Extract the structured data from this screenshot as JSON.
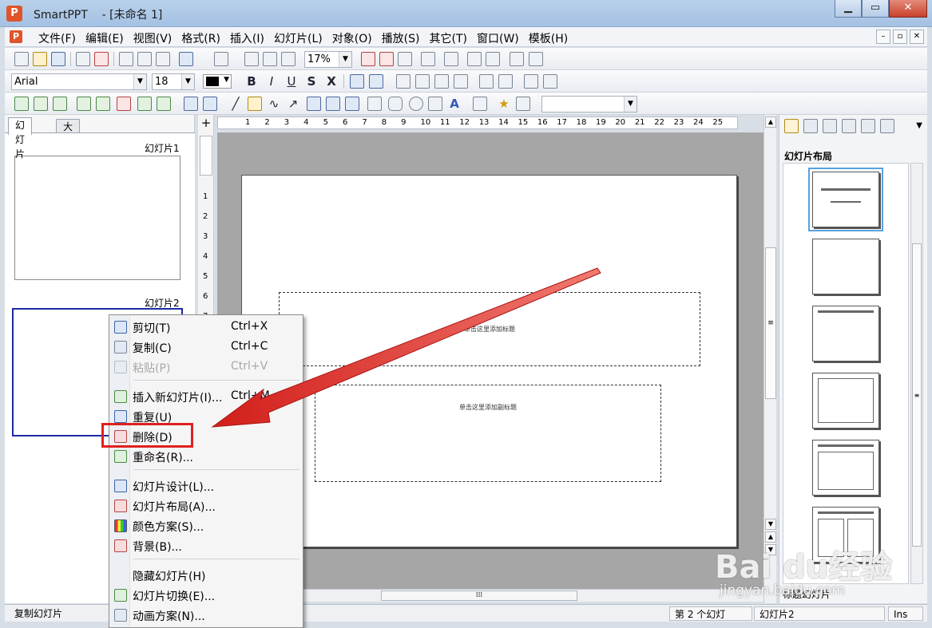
{
  "window": {
    "app_name": "SmartPPT",
    "doc_title": "- [未命名 1]",
    "logo_letter": "P",
    "minimize": "▁",
    "maximize": "▭",
    "close": "✕"
  },
  "menubar": {
    "items": [
      "文件(F)",
      "编辑(E)",
      "视图(V)",
      "格式(R)",
      "插入(I)",
      "幻灯片(L)",
      "对象(O)",
      "播放(S)",
      "其它(T)",
      "窗口(W)",
      "模板(H)"
    ],
    "mdi": [
      "–",
      "▫",
      "✕"
    ]
  },
  "toolbar1": {
    "zoom": "17%"
  },
  "toolbar2": {
    "font": "Arial",
    "size": "18",
    "bold": "B",
    "italic": "I",
    "underline": "U",
    "shadow": "S",
    "strike": "X"
  },
  "left_panel": {
    "tabs": [
      "幻灯片",
      "大纲"
    ],
    "slides": [
      {
        "label": "幻灯片1"
      },
      {
        "label": "幻灯片2"
      }
    ]
  },
  "ruler": {
    "h_ticks": [
      "1",
      "2",
      "3",
      "4",
      "5",
      "6",
      "7",
      "8",
      "9",
      "10",
      "11",
      "12",
      "13",
      "14",
      "15",
      "16",
      "17",
      "18",
      "19",
      "20",
      "21",
      "22",
      "23",
      "24",
      "25"
    ],
    "v_ticks": [
      "1",
      "2",
      "3",
      "4",
      "5",
      "6",
      "7"
    ]
  },
  "slide": {
    "title_placeholder": "单击这里添加标题",
    "subtitle_placeholder": "单击这里添加副标题"
  },
  "right_panel": {
    "title": "幻灯片布局",
    "footer": "标题幻灯片"
  },
  "context_menu": {
    "items": [
      {
        "label": "剪切(T)",
        "accel": "Ctrl+X",
        "icon": "scissors-icon",
        "disabled": false
      },
      {
        "label": "复制(C)",
        "accel": "Ctrl+C",
        "icon": "copy-icon",
        "disabled": false
      },
      {
        "label": "粘贴(P)",
        "accel": "Ctrl+V",
        "icon": "paste-icon",
        "disabled": true
      },
      {
        "label": "插入新幻灯片(I)...",
        "accel": "Ctrl+M",
        "icon": "new-slide-icon",
        "disabled": false
      },
      {
        "label": "重复(U)",
        "accel": "",
        "icon": "duplicate-icon",
        "disabled": false
      },
      {
        "label": "删除(D)",
        "accel": "",
        "icon": "delete-icon",
        "disabled": false
      },
      {
        "label": "重命名(R)...",
        "accel": "",
        "icon": "rename-icon",
        "disabled": false
      },
      {
        "label": "幻灯片设计(L)...",
        "accel": "",
        "icon": "design-icon",
        "disabled": false
      },
      {
        "label": "幻灯片布局(A)...",
        "accel": "",
        "icon": "layout-icon",
        "disabled": false
      },
      {
        "label": "颜色方案(S)...",
        "accel": "",
        "icon": "color-scheme-icon",
        "disabled": false
      },
      {
        "label": "背景(B)...",
        "accel": "",
        "icon": "background-icon",
        "disabled": false
      },
      {
        "label": "隐藏幻灯片(H)",
        "accel": "",
        "icon": "",
        "disabled": false
      },
      {
        "label": "幻灯片切换(E)...",
        "accel": "",
        "icon": "transition-icon",
        "disabled": false
      },
      {
        "label": "动画方案(N)...",
        "accel": "",
        "icon": "animation-icon",
        "disabled": false
      }
    ]
  },
  "statusbar": {
    "left": "复制幻灯片",
    "slide_of": "第 2 个幻灯",
    "slide_name": "幻灯片2",
    "mode": "Ins"
  },
  "watermark": {
    "brand": "Bai  du经验",
    "url": "jingyan.baidu.com"
  },
  "colors": {
    "highlight": "#e0201e",
    "selection": "#1a2aa3",
    "accent": "#e0542a"
  }
}
